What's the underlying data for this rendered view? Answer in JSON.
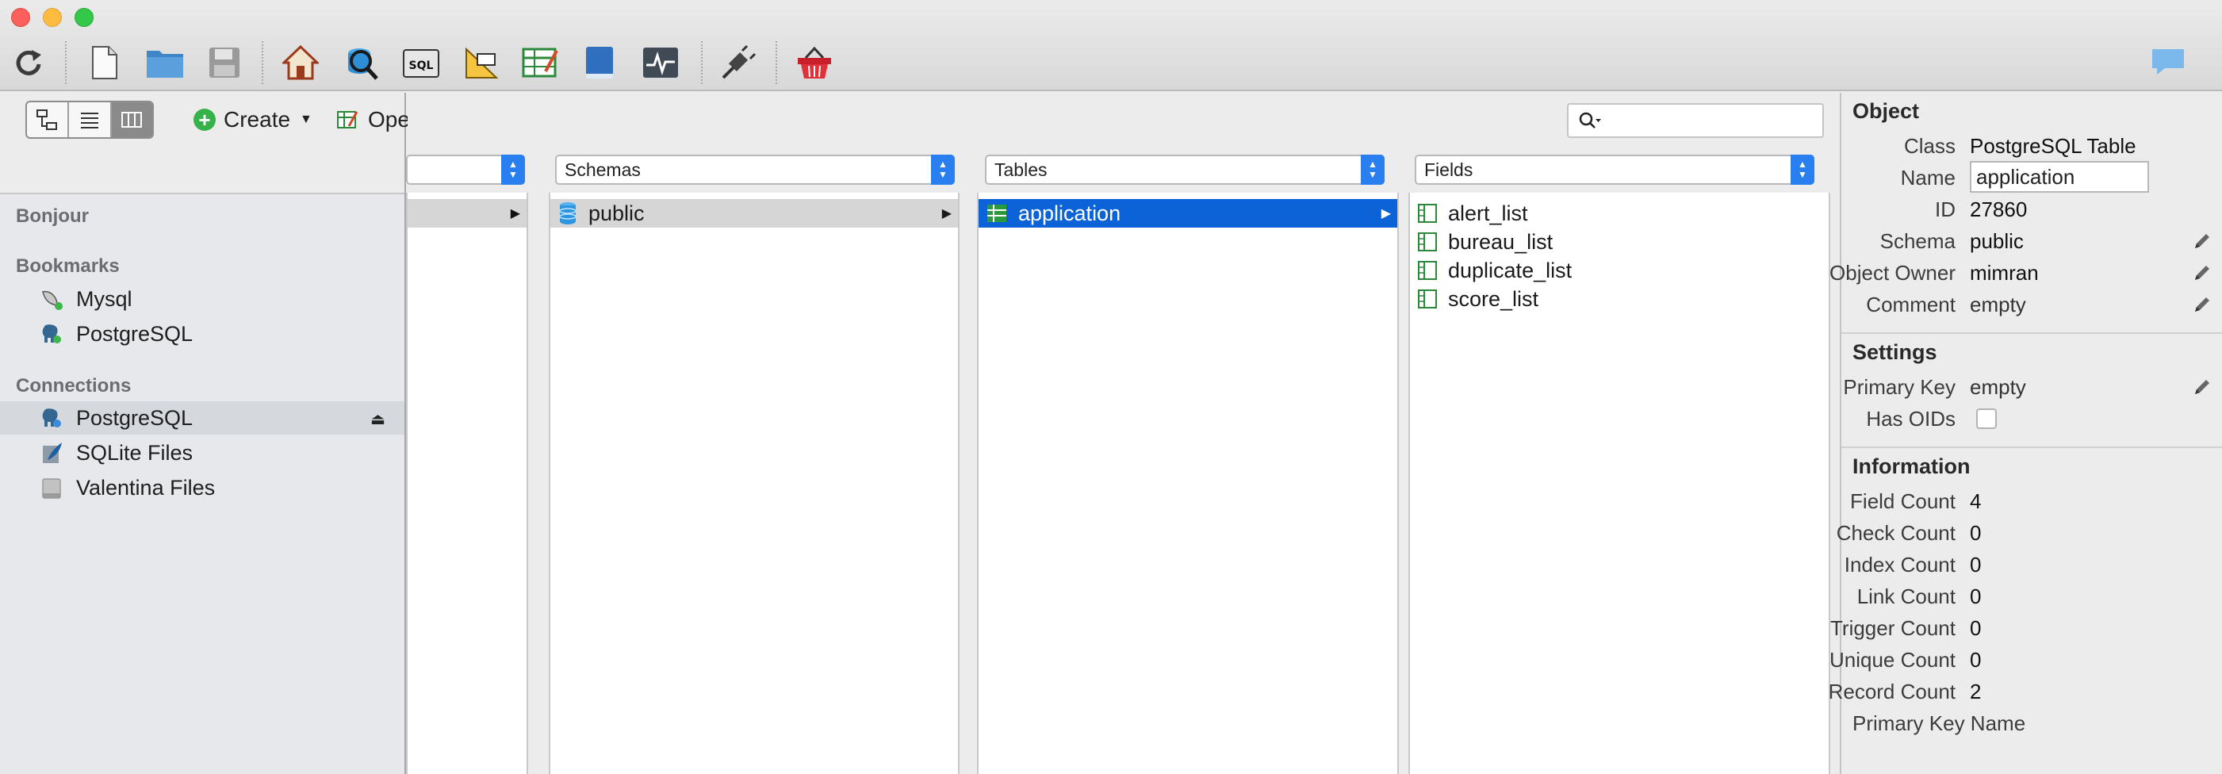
{
  "toolbar": {
    "buttons": [
      {
        "name": "refresh-icon"
      },
      {
        "name": "new-document-icon"
      },
      {
        "name": "open-folder-icon"
      },
      {
        "name": "save-icon"
      },
      {
        "name": "home-icon"
      },
      {
        "name": "database-search-icon"
      },
      {
        "name": "sql-icon"
      },
      {
        "name": "diagram-icon"
      },
      {
        "name": "table-editor-icon"
      },
      {
        "name": "book-icon"
      },
      {
        "name": "activity-monitor-icon"
      },
      {
        "name": "connect-plug-icon"
      },
      {
        "name": "basket-icon"
      }
    ]
  },
  "actions": {
    "create_label": "Create",
    "open_editor_label": "Open Data Editor"
  },
  "sidebar": {
    "bonjour_heading": "Bonjour",
    "bookmarks_heading": "Bookmarks",
    "bookmarks": [
      {
        "label": "Mysql",
        "icon": "mysql-dolphin-icon"
      },
      {
        "label": "PostgreSQL",
        "icon": "postgresql-elephant-icon"
      }
    ],
    "connections_heading": "Connections",
    "connections": [
      {
        "label": "PostgreSQL",
        "icon": "postgresql-elephant-icon",
        "selected": true
      },
      {
        "label": "SQLite Files",
        "icon": "sqlite-feather-icon"
      },
      {
        "label": "Valentina Files",
        "icon": "valentina-disk-icon"
      }
    ]
  },
  "browser": {
    "popups": {
      "schemas": "Schemas",
      "tables": "Tables",
      "fields": "Fields"
    },
    "schemas": [
      "public"
    ],
    "tables": [
      "application"
    ],
    "fields": [
      "alert_list",
      "bureau_list",
      "duplicate_list",
      "score_list"
    ]
  },
  "inspector": {
    "object_heading": "Object",
    "class_label": "Class",
    "class_value": "PostgreSQL Table",
    "name_label": "Name",
    "name_value": "application",
    "id_label": "ID",
    "id_value": "27860",
    "schema_label": "Schema",
    "schema_value": "public",
    "owner_label": "Object Owner",
    "owner_value": "mimran",
    "comment_label": "Comment",
    "comment_value": "empty",
    "settings_heading": "Settings",
    "pk_label": "Primary Key",
    "pk_value": "empty",
    "oids_label": "Has OIDs",
    "has_oids": false,
    "information_heading": "Information",
    "info_rows": [
      {
        "label": "Field Count",
        "value": "4"
      },
      {
        "label": "Check Count",
        "value": "0"
      },
      {
        "label": "Index Count",
        "value": "0"
      },
      {
        "label": "Link Count",
        "value": "0"
      },
      {
        "label": "Trigger Count",
        "value": "0"
      },
      {
        "label": "Unique Count",
        "value": "0"
      },
      {
        "label": "Record Count",
        "value": "2"
      }
    ],
    "pk_name_label": "Primary Key Name"
  },
  "colors": {
    "selection_blue": "#0c63d8",
    "popup_blue": "#2a7ff0",
    "create_green": "#35b34a"
  }
}
